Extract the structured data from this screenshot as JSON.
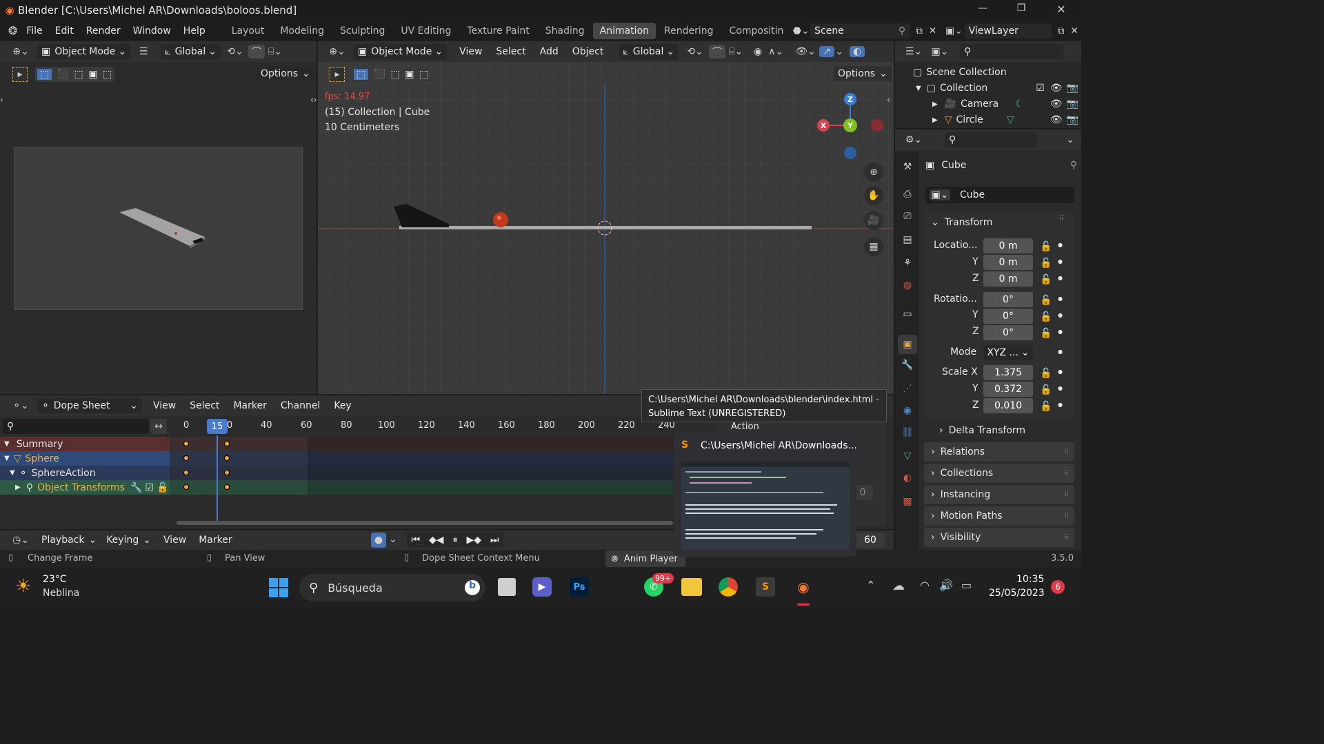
{
  "window": {
    "title": "Blender [C:\\Users\\Michel AR\\Downloads\\boloos.blend]",
    "min": "—",
    "max": "❐",
    "close": "✕"
  },
  "menu": {
    "items": [
      "File",
      "Edit",
      "Render",
      "Window",
      "Help"
    ],
    "workspaces": [
      "Layout",
      "Modeling",
      "Sculpting",
      "UV Editing",
      "Texture Paint",
      "Shading",
      "Animation",
      "Rendering",
      "Compositin"
    ],
    "active_ws": "Animation",
    "scene": "Scene",
    "viewlayer": "ViewLayer"
  },
  "left_view": {
    "mode": "Object Mode",
    "orient": "Global",
    "options": "Options"
  },
  "main_view": {
    "mode": "Object Mode",
    "menus": [
      "View",
      "Select",
      "Add",
      "Object"
    ],
    "orient": "Global",
    "options": "Options",
    "fps": "fps: 14.97",
    "info": "(15) Collection | Cube",
    "scale": "10 Centimeters",
    "gizmo": {
      "x": "X",
      "y": "Y",
      "z": "Z"
    }
  },
  "outliner": {
    "items": [
      {
        "label": "Scene Collection"
      },
      {
        "label": "Collection"
      },
      {
        "label": "Camera"
      },
      {
        "label": "Circle"
      }
    ]
  },
  "props": {
    "object": "Cube",
    "data": "Cube",
    "transform": "Transform",
    "loc_label": "Locatio...",
    "rot_label": "Rotatio...",
    "mode_label": "Mode",
    "scale_label": "Scale X",
    "y": "Y",
    "z": "Z",
    "loc": [
      "0 m",
      "0 m",
      "0 m"
    ],
    "rot": [
      "0°",
      "0°",
      "0°"
    ],
    "mode": "XYZ ...",
    "scale": [
      "1.375",
      "0.372",
      "0.010"
    ],
    "panels": [
      "Delta Transform",
      "Relations",
      "Collections",
      "Instancing",
      "Motion Paths",
      "Visibility"
    ]
  },
  "dope": {
    "editor": "Dope Sheet",
    "menus": [
      "View",
      "Select",
      "Marker",
      "Channel",
      "Key"
    ],
    "frames": [
      "0",
      "40",
      "60",
      "80",
      "100",
      "120",
      "140",
      "160",
      "180",
      "200",
      "220",
      "240"
    ],
    "current": "15",
    "current_suffix": "0",
    "channels": [
      "Summary",
      "Sphere",
      "SphereAction",
      "Object Transforms"
    ],
    "action": "Action",
    "zero": "0"
  },
  "timeline": {
    "playback": "Playback",
    "keying": "Keying",
    "view": "View",
    "marker": "Marker",
    "end": "60"
  },
  "status": {
    "change": "Change Frame",
    "pan": "Pan View",
    "context": "Dope Sheet Context Menu",
    "anim": "Anim Player",
    "version": "3.5.0"
  },
  "tooltip": {
    "line1": "C:\\Users\\Michel AR\\Downloads\\blender\\index.html -",
    "line2": "Sublime Text (UNREGISTERED)",
    "thumb": "C:\\Users\\Michel AR\\Downloads..."
  },
  "taskbar": {
    "temp": "23°C",
    "weather": "Neblina",
    "search": "Búsqueda",
    "badge": "99+",
    "time": "10:35",
    "date": "25/05/2023",
    "notif": "6"
  }
}
